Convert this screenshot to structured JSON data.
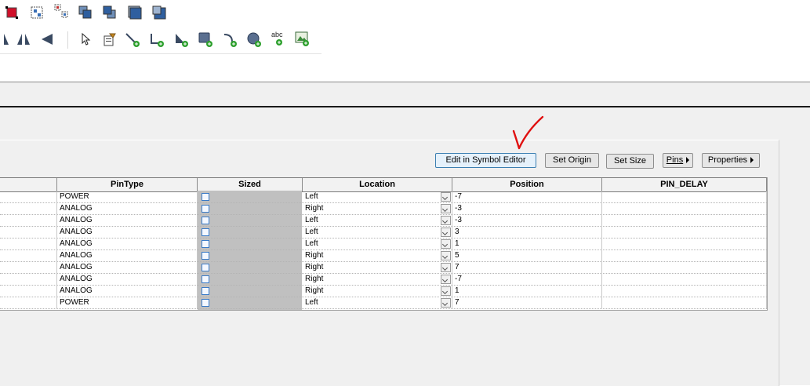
{
  "toolbar": {
    "row1_icons": [
      "red-fill-icon",
      "select-group-icon",
      "ungroup-icon",
      "bring-forward-icon",
      "send-backward-icon",
      "bring-to-front-icon",
      "send-to-back-icon"
    ],
    "row2_icons": [
      "flip-vertical-icon",
      "flip-horizontal-icon",
      "rotate-icon",
      "pointer-icon",
      "edit-properties-icon",
      "add-line-icon",
      "add-polyline-icon",
      "add-polygon-icon",
      "add-rectangle-icon",
      "add-arc-icon",
      "add-circle-icon",
      "add-text-icon",
      "add-image-icon"
    ]
  },
  "buttons": {
    "edit_symbol": "Edit in Symbol Editor",
    "set_origin": "Set Origin",
    "set_size": "Set Size",
    "pins": "Pins",
    "properties": "Properties"
  },
  "grid": {
    "columns": [
      "PinType",
      "Sized",
      "Location",
      "Position",
      "PIN_DELAY"
    ],
    "rows": [
      {
        "pintype": "POWER",
        "location": "Left",
        "position": "-7"
      },
      {
        "pintype": "ANALOG",
        "location": "Right",
        "position": "-3"
      },
      {
        "pintype": "ANALOG",
        "location": "Left",
        "position": "-3"
      },
      {
        "pintype": "ANALOG",
        "location": "Left",
        "position": "3"
      },
      {
        "pintype": "ANALOG",
        "location": "Left",
        "position": "1"
      },
      {
        "pintype": "ANALOG",
        "location": "Right",
        "position": "5"
      },
      {
        "pintype": "ANALOG",
        "location": "Right",
        "position": "7"
      },
      {
        "pintype": "ANALOG",
        "location": "Right",
        "position": "-7"
      },
      {
        "pintype": "ANALOG",
        "location": "Right",
        "position": "1"
      },
      {
        "pintype": "POWER",
        "location": "Left",
        "position": "7"
      }
    ]
  },
  "colors": {
    "annotation_check": "#e01010",
    "sized_column_bg": "#c0c0c0",
    "checkbox_border": "#3a7bc8"
  }
}
